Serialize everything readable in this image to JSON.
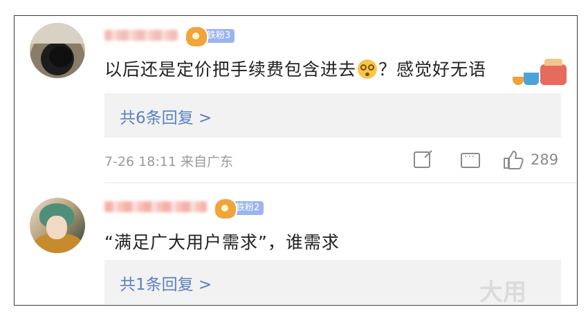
{
  "comments": [
    {
      "fan_badge": "铁粉3",
      "text_before_emoji": "以后还是定价把手续费包含进去",
      "text_after_emoji": "？感觉好无语",
      "reply_link": "共6条回复 >",
      "timestamp": "7-26 18:11 来自广东",
      "like_count": "289"
    },
    {
      "fan_badge": "铁粉2",
      "text": "“满足广大用户需求”，谁需求",
      "reply_link": "共1条回复 >"
    }
  ],
  "watermark": "大用"
}
